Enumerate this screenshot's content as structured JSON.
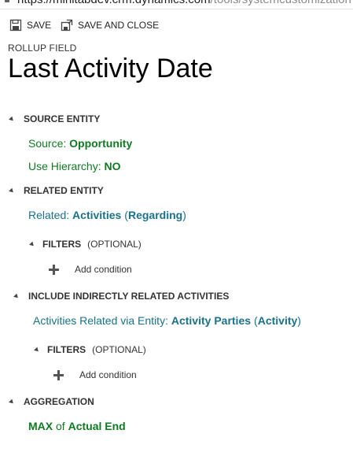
{
  "browser": {
    "url_host": "https://minitabdev.crm.dynamics.com",
    "url_path": "/tools/systemcustomization"
  },
  "toolbar": {
    "save_label": "SAVE",
    "save_close_label": "SAVE AND CLOSE"
  },
  "form": {
    "type_label": "ROLLUP FIELD",
    "title": "Last Activity Date"
  },
  "source_entity": {
    "header": "SOURCE ENTITY",
    "source_label": "Source:",
    "source_value": "Opportunity",
    "hierarchy_label": "Use Hierarchy:",
    "hierarchy_value": "NO"
  },
  "related_entity": {
    "header": "RELATED ENTITY",
    "related_label": "Related:",
    "related_entity": "Activities",
    "paren_open": "(",
    "related_relationship": "Regarding",
    "paren_close": ")",
    "filters_label": "FILTERS",
    "filters_optional": "(OPTIONAL)",
    "add_condition": "Add condition"
  },
  "indirect": {
    "header": "INCLUDE INDIRECTLY RELATED ACTIVITIES",
    "via_label": "Activities Related via Entity:",
    "via_entity": "Activity Parties",
    "paren_open": "(",
    "via_relationship": "Activity",
    "paren_close": ")",
    "filters_label": "FILTERS",
    "filters_optional": "(OPTIONAL)",
    "add_condition": "Add condition"
  },
  "aggregation": {
    "header": "AGGREGATION",
    "function": "MAX",
    "of_label": "of",
    "field": "Actual End"
  },
  "colors": {
    "link_teal": "#1a7289",
    "value_green": "#0f7a22"
  },
  "icons": {
    "save": "floppy-disk-icon",
    "save_close": "save-and-close-icon",
    "section_toggle": "collapse-triangle-icon",
    "add": "plus-icon"
  }
}
